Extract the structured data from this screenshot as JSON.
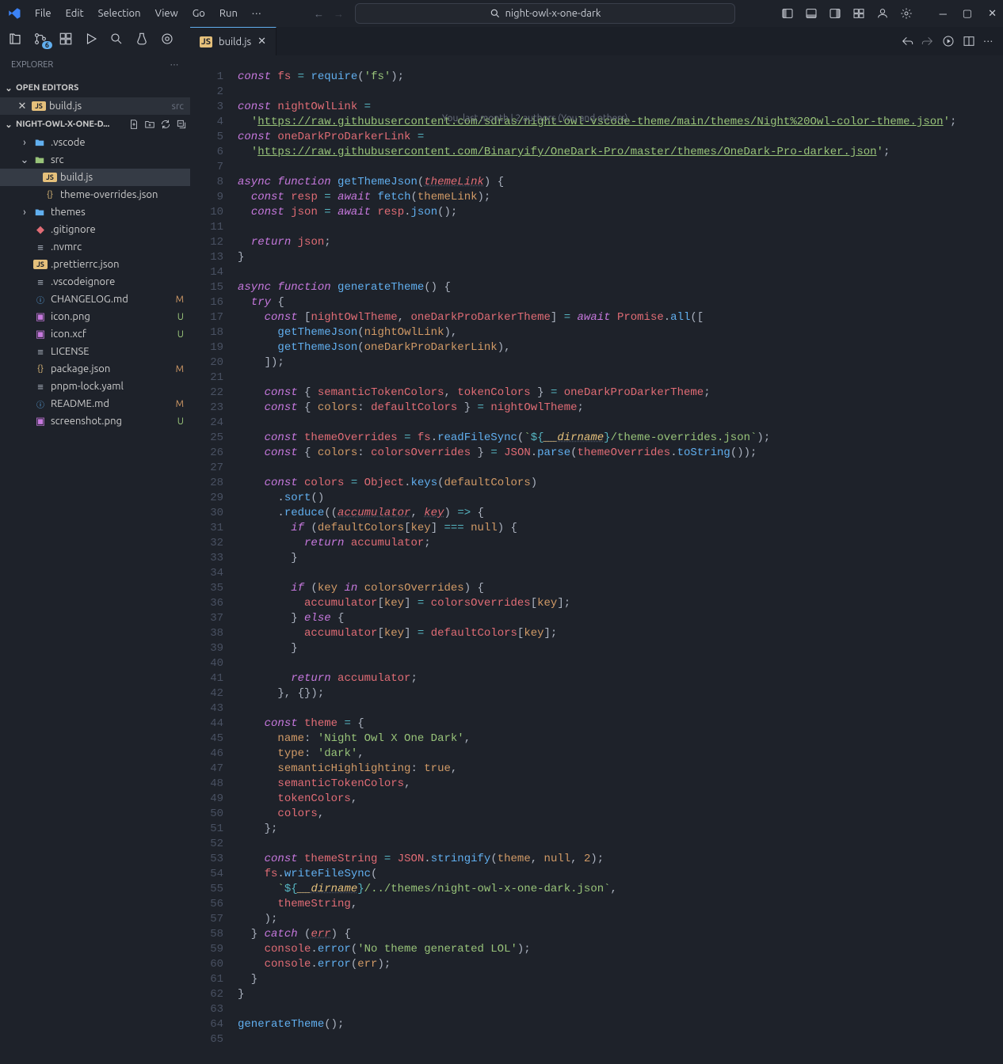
{
  "menubar": [
    "File",
    "Edit",
    "Selection",
    "View",
    "Go",
    "Run"
  ],
  "search_placeholder": "night-owl-x-one-dark",
  "explorer_title": "EXPLORER",
  "open_editors_title": "OPEN EDITORS",
  "workspace_title": "NIGHT-OWL-X-ONE-D...",
  "open_editors": [
    {
      "name": "build.js",
      "suffix": "src"
    }
  ],
  "tree": [
    {
      "indent": 1,
      "chev": "right",
      "icon": "folder",
      "iconClass": "folder-icon",
      "label": ".vscode"
    },
    {
      "indent": 1,
      "chev": "down",
      "icon": "folder",
      "iconClass": "folder-icon src",
      "label": "src"
    },
    {
      "indent": 2,
      "chev": "",
      "icon": "js",
      "iconClass": "js-icon",
      "label": "build.js",
      "selected": true
    },
    {
      "indent": 2,
      "chev": "",
      "icon": "json",
      "iconClass": "json-icon",
      "label": "theme-overrides.json"
    },
    {
      "indent": 1,
      "chev": "right",
      "icon": "folder",
      "iconClass": "folder-icon",
      "label": "themes"
    },
    {
      "indent": 1,
      "chev": "",
      "icon": "git",
      "iconClass": "git-icon",
      "label": ".gitignore"
    },
    {
      "indent": 1,
      "chev": "",
      "icon": "txt",
      "iconClass": "txt-icon",
      "label": ".nvmrc"
    },
    {
      "indent": 1,
      "chev": "",
      "icon": "js",
      "iconClass": "js-icon",
      "label": ".prettierrc.json"
    },
    {
      "indent": 1,
      "chev": "",
      "icon": "txt",
      "iconClass": "txt-icon",
      "label": ".vscodeignore"
    },
    {
      "indent": 1,
      "chev": "",
      "icon": "md",
      "iconClass": "md-icon",
      "label": "CHANGELOG.md",
      "badge": "M",
      "badgeClass": "m"
    },
    {
      "indent": 1,
      "chev": "",
      "icon": "img",
      "iconClass": "img-icon",
      "label": "icon.png",
      "badge": "U",
      "badgeClass": "u"
    },
    {
      "indent": 1,
      "chev": "",
      "icon": "img",
      "iconClass": "img-icon",
      "label": "icon.xcf",
      "badge": "U",
      "badgeClass": "u"
    },
    {
      "indent": 1,
      "chev": "",
      "icon": "txt",
      "iconClass": "txt-icon",
      "label": "LICENSE"
    },
    {
      "indent": 1,
      "chev": "",
      "icon": "json",
      "iconClass": "json-icon",
      "label": "package.json",
      "badge": "M",
      "badgeClass": "m"
    },
    {
      "indent": 1,
      "chev": "",
      "icon": "txt",
      "iconClass": "txt-icon",
      "label": "pnpm-lock.yaml"
    },
    {
      "indent": 1,
      "chev": "",
      "icon": "md",
      "iconClass": "md-icon",
      "label": "README.md",
      "badge": "M",
      "badgeClass": "m"
    },
    {
      "indent": 1,
      "chev": "",
      "icon": "img",
      "iconClass": "img-icon",
      "label": "screenshot.png",
      "badge": "U",
      "badgeClass": "u"
    }
  ],
  "tab": {
    "label": "build.js"
  },
  "codelens": "You, last month | 2 authors (You and others)",
  "code_lines": [
    "<span class='k'>const</span> <span class='v'>fs</span> <span class='op'>=</span> <span class='fn'>require</span>(<span class='s'>'fs'</span>);",
    "",
    "<span class='k'>const</span> <span class='v'>nightOwlLink</span> <span class='op'>=</span>",
    "  <span class='s'>'<span class='url'>https://raw.githubusercontent.com/sdras/night-owl-vscode-theme/main/themes/Night%20Owl-color-theme.json</span>'</span>;",
    "<span class='k'>const</span> <span class='v'>oneDarkProDarkerLink</span> <span class='op'>=</span>",
    "  <span class='s'>'<span class='url'>https://raw.githubusercontent.com/Binaryify/OneDark-Pro/master/themes/OneDark-Pro-darker.json</span>'</span>;",
    "",
    "<span class='k'>async</span> <span class='k'>function</span> <span class='fn'>getThemeJson</span>(<span class='pm'>themeLink</span>) {",
    "  <span class='k'>const</span> <span class='v'>resp</span> <span class='op'>=</span> <span class='k'>await</span> <span class='fn'>fetch</span>(<span class='p'>themeLink</span>);",
    "  <span class='k'>const</span> <span class='v'>json</span> <span class='op'>=</span> <span class='k'>await</span> <span class='v'>resp</span>.<span class='fn'>json</span>();",
    "",
    "  <span class='k'>return</span> <span class='v'>json</span>;",
    "}",
    "",
    "<span class='k'>async</span> <span class='k'>function</span> <span class='fn'>generateTheme</span>() {",
    "  <span class='k'>try</span> {",
    "    <span class='k'>const</span> [<span class='v'>nightOwlTheme</span>, <span class='v'>oneDarkProDarkerTheme</span>] <span class='op'>=</span> <span class='k'>await</span> <span class='v'>Promise</span>.<span class='fn'>all</span>([",
    "      <span class='fn'>getThemeJson</span>(<span class='p'>nightOwlLink</span>),",
    "      <span class='fn'>getThemeJson</span>(<span class='p'>oneDarkProDarkerLink</span>),",
    "    ]);",
    "",
    "    <span class='k'>const</span> { <span class='v'>semanticTokenColors</span>, <span class='v'>tokenColors</span> } <span class='op'>=</span> <span class='v'>oneDarkProDarkerTheme</span>;",
    "    <span class='k'>const</span> { <span class='p'>colors</span>: <span class='v'>defaultColors</span> } <span class='op'>=</span> <span class='v'>nightOwlTheme</span>;",
    "",
    "    <span class='k'>const</span> <span class='v'>themeOverrides</span> <span class='op'>=</span> <span class='v'>fs</span>.<span class='fn'>readFileSync</span>(<span class='s'>`</span><span class='op'>${</span><span class='id'>__dirname</span><span class='op'>}</span><span class='s'>/theme-overrides.json`</span>);",
    "    <span class='k'>const</span> { <span class='p'>colors</span>: <span class='v'>colorsOverrides</span> } <span class='op'>=</span> <span class='v'>JSON</span>.<span class='fn'>parse</span>(<span class='v'>themeOverrides</span>.<span class='fn'>toString</span>());",
    "",
    "    <span class='k'>const</span> <span class='v'>colors</span> <span class='op'>=</span> <span class='v'>Object</span>.<span class='fn'>keys</span>(<span class='p'>defaultColors</span>)",
    "      .<span class='fn'>sort</span>()",
    "      .<span class='fn'>reduce</span>((<span class='pm'>accumulator</span>, <span class='pm'>key</span>) <span class='op'>=&gt;</span> {",
    "        <span class='k'>if</span> (<span class='p'>defaultColors</span>[<span class='p'>key</span>] <span class='op'>===</span> <span class='p'>null</span>) {",
    "          <span class='k'>return</span> <span class='v'>accumulator</span>;",
    "        }",
    "",
    "        <span class='k'>if</span> (<span class='p'>key</span> <span class='k'>in</span> <span class='p'>colorsOverrides</span>) {",
    "          <span class='v'>accumulator</span>[<span class='p'>key</span>] <span class='op'>=</span> <span class='v'>colorsOverrides</span>[<span class='p'>key</span>];",
    "        } <span class='k'>else</span> {",
    "          <span class='v'>accumulator</span>[<span class='p'>key</span>] <span class='op'>=</span> <span class='v'>defaultColors</span>[<span class='p'>key</span>];",
    "        }",
    "",
    "        <span class='k'>return</span> <span class='v'>accumulator</span>;",
    "      }, {});",
    "",
    "    <span class='k'>const</span> <span class='v'>theme</span> <span class='op'>=</span> {",
    "      <span class='p'>name</span>: <span class='s'>'Night Owl X One Dark'</span>,",
    "      <span class='p'>type</span>: <span class='s'>'dark'</span>,",
    "      <span class='p'>semanticHighlighting</span>: <span class='p'>true</span>,",
    "      <span class='v'>semanticTokenColors</span>,",
    "      <span class='v'>tokenColors</span>,",
    "      <span class='v'>colors</span>,",
    "    };",
    "",
    "    <span class='k'>const</span> <span class='v'>themeString</span> <span class='op'>=</span> <span class='v'>JSON</span>.<span class='fn'>stringify</span>(<span class='p'>theme</span>, <span class='p'>null</span>, <span class='p'>2</span>);",
    "    <span class='v'>fs</span>.<span class='fn'>writeFileSync</span>(",
    "      <span class='s'>`</span><span class='op'>${</span><span class='id'>__dirname</span><span class='op'>}</span><span class='s'>/../themes/night-owl-x-one-dark.json`</span>,",
    "      <span class='v'>themeString</span>,",
    "    );",
    "  } <span class='k'>catch</span> (<span class='pm'>err</span>) {",
    "    <span class='v'>console</span>.<span class='fn'>error</span>(<span class='s'>'No theme generated LOL'</span>);",
    "    <span class='v'>console</span>.<span class='fn'>error</span>(<span class='p'>err</span>);",
    "  }",
    "}",
    "",
    "<span class='fn'>generateTheme</span>();",
    ""
  ]
}
